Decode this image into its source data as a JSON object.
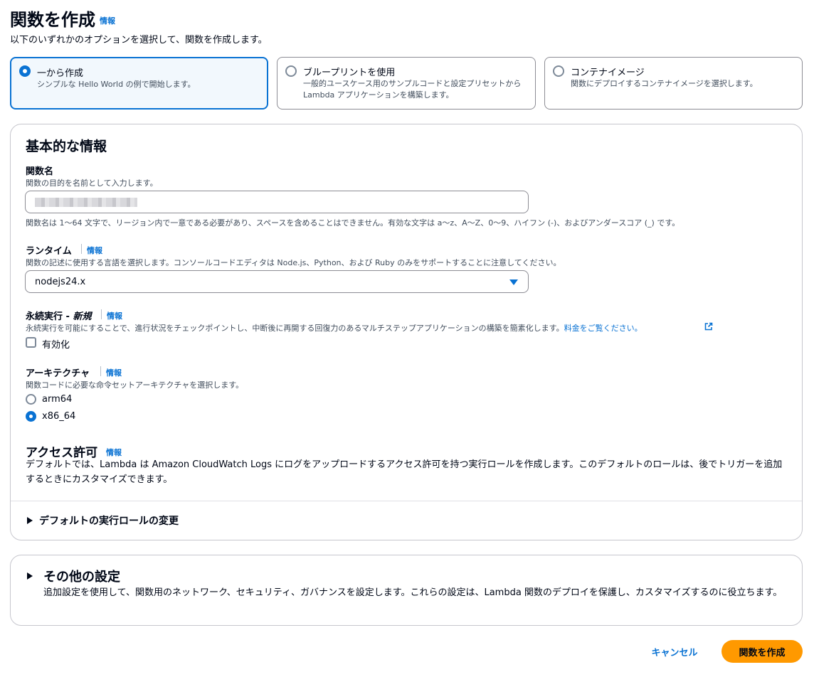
{
  "header": {
    "title": "関数を作成",
    "info": "情報",
    "description": "以下のいずれかのオプションを選択して、関数を作成します。"
  },
  "options": [
    {
      "label": "一から作成",
      "description": "シンプルな Hello World の例で開始します。",
      "selected": true
    },
    {
      "label": "ブループリントを使用",
      "description": "一般的ユースケース用のサンプルコードと設定プリセットから Lambda アプリケーションを構築します。",
      "selected": false
    },
    {
      "label": "コンテナイメージ",
      "description": "関数にデプロイするコンテナイメージを選択します。",
      "selected": false
    }
  ],
  "basic": {
    "title": "基本的な情報",
    "function_name": {
      "label": "関数名",
      "description": "関数の目的を名前として入力します。",
      "constraint": "関数名は 1〜64 文字で、リージョン内で一意である必要があり、スペースを含めることはできません。有効な文字は a〜z、A〜Z、0〜9、ハイフン (-)、およびアンダースコア (_) です。"
    },
    "runtime": {
      "label": "ランタイム",
      "info": "情報",
      "description": "関数の記述に使用する言語を選択します。コンソールコードエディタは Node.js、Python、および Ruby のみをサポートすることに注意してください。",
      "value": "nodejs24.x"
    },
    "durable": {
      "label": "永続実行 - ",
      "label_new": "新規",
      "info": "情報",
      "description": "永続実行を可能にすることで、進行状況をチェックポイントし、中断後に再開する回復力のあるマルチステップアプリケーションの構築を簡素化します。",
      "pricing_link": "料金をご覧ください。",
      "checkbox_label": "有効化",
      "checked": false
    },
    "architecture": {
      "label": "アーキテクチャ",
      "info": "情報",
      "description": "関数コードに必要な命令セットアーキテクチャを選択します。",
      "options": [
        "arm64",
        "x86_64"
      ],
      "selected": "x86_64"
    },
    "access": {
      "title": "アクセス許可",
      "info": "情報",
      "description": "デフォルトでは、Lambda は Amazon CloudWatch Logs にログをアップロードするアクセス許可を持つ実行ロールを作成します。このデフォルトのロールは、後でトリガーを追加するときにカスタマイズできます。"
    },
    "role_expander": "デフォルトの実行ロールの変更"
  },
  "other": {
    "title": "その他の設定",
    "description": "追加設定を使用して、関数用のネットワーク、セキュリティ、ガバナンスを設定します。これらの設定は、Lambda 関数のデプロイを保護し、カスタマイズするのに役立ちます。"
  },
  "footer": {
    "cancel": "キャンセル",
    "create": "関数を作成"
  },
  "colors": {
    "accent": "#0972d3",
    "primary_button": "#ff9900"
  }
}
